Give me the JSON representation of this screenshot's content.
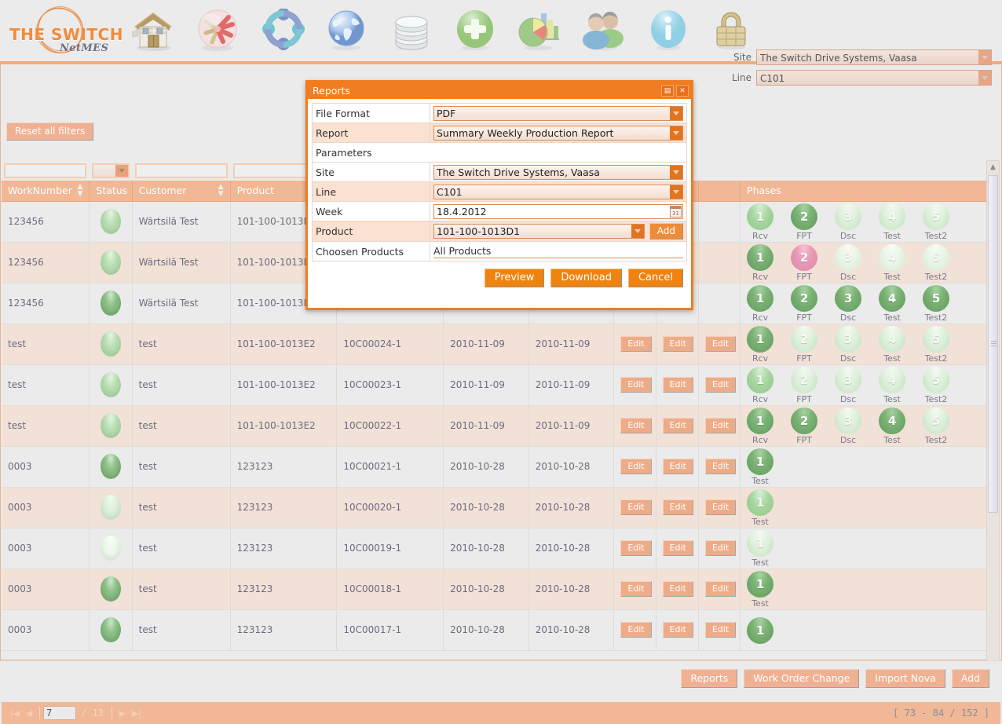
{
  "app": {
    "brand": "THE SWITCH",
    "brand_sub": "NetMES",
    "toolbar": [
      {
        "name": "home-icon",
        "label": "Home"
      },
      {
        "name": "production-icon",
        "label": "Production"
      },
      {
        "name": "lifering-icon",
        "label": "Support"
      },
      {
        "name": "globe-icon",
        "label": "Global"
      },
      {
        "name": "database-icon",
        "label": "Database"
      },
      {
        "name": "add-icon",
        "label": "Add"
      },
      {
        "name": "chart-icon",
        "label": "Reports"
      },
      {
        "name": "users-icon",
        "label": "Users"
      },
      {
        "name": "info-icon",
        "label": "Info"
      },
      {
        "name": "lock-icon",
        "label": "Security"
      }
    ]
  },
  "filters": {
    "reset_label": "Reset all filters",
    "site_label": "Site",
    "site_value": "The Switch Drive Systems, Vaasa",
    "line_label": "Line",
    "line_value": "C101"
  },
  "grid": {
    "columns": [
      {
        "key": "worknumber",
        "label": "WorkNumber",
        "sortable": true
      },
      {
        "key": "status",
        "label": "Status",
        "sortable": false
      },
      {
        "key": "customer",
        "label": "Customer",
        "sortable": true
      },
      {
        "key": "product",
        "label": "Product",
        "sortable": true
      },
      {
        "key": "serial",
        "label": "",
        "sortable": false
      },
      {
        "key": "date1",
        "label": "",
        "sortable": false
      },
      {
        "key": "date2",
        "label": "",
        "sortable": false
      },
      {
        "key": "edit1",
        "label": "",
        "sortable": false
      },
      {
        "key": "edit2",
        "label": "",
        "sortable": false
      },
      {
        "key": "edit3",
        "label": "",
        "sortable": false
      },
      {
        "key": "phases",
        "label": "Phases",
        "sortable": false
      }
    ],
    "edit_label": "Edit",
    "rows": [
      {
        "worknumber": "123456",
        "status": "mid",
        "customer": "Wärtsilä Test",
        "product": "101-100-1013E2",
        "serial": "",
        "date1": "",
        "date2": "",
        "edits": 0,
        "phases": [
          {
            "n": "1",
            "label": "Rcv",
            "state": "half"
          },
          {
            "n": "2",
            "label": "FPT",
            "state": "done"
          },
          {
            "n": "3",
            "label": "Dsc",
            "state": "todo"
          },
          {
            "n": "4",
            "label": "Test",
            "state": "todo"
          },
          {
            "n": "5",
            "label": "Test2",
            "state": "todo"
          }
        ]
      },
      {
        "worknumber": "123456",
        "status": "mid",
        "customer": "Wärtsilä Test",
        "product": "101-100-1013E2",
        "serial": "",
        "date1": "",
        "date2": "",
        "edits": 0,
        "phases": [
          {
            "n": "1",
            "label": "Rcv",
            "state": "done"
          },
          {
            "n": "2",
            "label": "FPT",
            "state": "pink"
          },
          {
            "n": "3",
            "label": "Dsc",
            "state": "pend"
          },
          {
            "n": "4",
            "label": "Test",
            "state": "pend"
          },
          {
            "n": "5",
            "label": "Test2",
            "state": "pend"
          }
        ]
      },
      {
        "worknumber": "123456",
        "status": "dark",
        "customer": "Wärtsilä Test",
        "product": "101-100-1013E2",
        "serial": "",
        "date1": "",
        "date2": "",
        "edits": 0,
        "phases": [
          {
            "n": "1",
            "label": "Rcv",
            "state": "done"
          },
          {
            "n": "2",
            "label": "FPT",
            "state": "done"
          },
          {
            "n": "3",
            "label": "Dsc",
            "state": "done"
          },
          {
            "n": "4",
            "label": "Test",
            "state": "done"
          },
          {
            "n": "5",
            "label": "Test2",
            "state": "done"
          }
        ]
      },
      {
        "worknumber": "test",
        "status": "mid",
        "customer": "test",
        "product": "101-100-1013E2",
        "serial": "10C00024-1",
        "date1": "2010-11-09",
        "date2": "2010-11-09",
        "edits": 3,
        "phases": [
          {
            "n": "1",
            "label": "Rcv",
            "state": "done"
          },
          {
            "n": "2",
            "label": "FPT",
            "state": "todo"
          },
          {
            "n": "3",
            "label": "Dsc",
            "state": "todo"
          },
          {
            "n": "4",
            "label": "Test",
            "state": "todo"
          },
          {
            "n": "5",
            "label": "Test2",
            "state": "todo"
          }
        ]
      },
      {
        "worknumber": "test",
        "status": "mid",
        "customer": "test",
        "product": "101-100-1013E2",
        "serial": "10C00023-1",
        "date1": "2010-11-09",
        "date2": "2010-11-09",
        "edits": 3,
        "phases": [
          {
            "n": "1",
            "label": "Rcv",
            "state": "half"
          },
          {
            "n": "2",
            "label": "FPT",
            "state": "todo"
          },
          {
            "n": "3",
            "label": "Dsc",
            "state": "todo"
          },
          {
            "n": "4",
            "label": "Test",
            "state": "todo"
          },
          {
            "n": "5",
            "label": "Test2",
            "state": "todo"
          }
        ]
      },
      {
        "worknumber": "test",
        "status": "mid",
        "customer": "test",
        "product": "101-100-1013E2",
        "serial": "10C00022-1",
        "date1": "2010-11-09",
        "date2": "2010-11-09",
        "edits": 3,
        "phases": [
          {
            "n": "1",
            "label": "Rcv",
            "state": "done"
          },
          {
            "n": "2",
            "label": "FPT",
            "state": "done"
          },
          {
            "n": "3",
            "label": "Dsc",
            "state": "todo"
          },
          {
            "n": "4",
            "label": "Test",
            "state": "done"
          },
          {
            "n": "5",
            "label": "Test2",
            "state": "todo"
          }
        ]
      },
      {
        "worknumber": "0003",
        "status": "dark",
        "customer": "test",
        "product": "123123",
        "serial": "10C00021-1",
        "date1": "2010-10-28",
        "date2": "2010-10-28",
        "edits": 3,
        "phases": [
          {
            "n": "1",
            "label": "Test",
            "state": "done"
          }
        ]
      },
      {
        "worknumber": "0003",
        "status": "light",
        "customer": "test",
        "product": "123123",
        "serial": "10C00020-1",
        "date1": "2010-10-28",
        "date2": "2010-10-28",
        "edits": 3,
        "phases": [
          {
            "n": "1",
            "label": "Test",
            "state": "half"
          }
        ]
      },
      {
        "worknumber": "0003",
        "status": "pale",
        "customer": "test",
        "product": "123123",
        "serial": "10C00019-1",
        "date1": "2010-10-28",
        "date2": "2010-10-28",
        "edits": 3,
        "phases": [
          {
            "n": "1",
            "label": "Test",
            "state": "todo"
          }
        ]
      },
      {
        "worknumber": "0003",
        "status": "dark",
        "customer": "test",
        "product": "123123",
        "serial": "10C00018-1",
        "date1": "2010-10-28",
        "date2": "2010-10-28",
        "edits": 3,
        "phases": [
          {
            "n": "1",
            "label": "Test",
            "state": "done"
          }
        ]
      },
      {
        "worknumber": "0003",
        "status": "dark",
        "customer": "test",
        "product": "123123",
        "serial": "10C00017-1",
        "date1": "2010-10-28",
        "date2": "2010-10-28",
        "edits": 3,
        "phases": [
          {
            "n": "1",
            "label": "",
            "state": "done"
          }
        ]
      }
    ]
  },
  "pager": {
    "first_icon": "|◀",
    "prev_icon": "◀",
    "next_icon": "▶",
    "last_icon": "▶|",
    "page": "7",
    "total_pages": "/ 13",
    "range": "[ 73 - 84 / 152 ]"
  },
  "footer": {
    "buttons": [
      {
        "name": "reports-button",
        "label": "Reports"
      },
      {
        "name": "work-order-change-button",
        "label": "Work Order Change"
      },
      {
        "name": "import-nova-button",
        "label": "Import Nova"
      },
      {
        "name": "add-button",
        "label": "Add"
      }
    ]
  },
  "dialog": {
    "title": "Reports",
    "restore_icon": "▤",
    "close_icon": "✕",
    "fields": {
      "file_format_label": "File Format",
      "file_format_value": "PDF",
      "report_label": "Report",
      "report_value": "Summary Weekly Production Report",
      "parameters_label": "Parameters",
      "site_label": "Site",
      "site_value": "The Switch Drive Systems, Vaasa",
      "line_label": "Line",
      "line_value": "C101",
      "week_label": "Week",
      "week_value": "18.4.2012",
      "product_label": "Product",
      "product_value": "101-100-1013D1",
      "add_label": "Add",
      "choosen_label": "Choosen Products",
      "choosen_value": "All Products"
    },
    "buttons": {
      "preview": "Preview",
      "download": "Download",
      "cancel": "Cancel"
    }
  },
  "colors": {
    "accent": "#f07d22",
    "header": "#f0b896",
    "page_bg": "#ebebeb",
    "row_alt": "#f2e1d7"
  }
}
